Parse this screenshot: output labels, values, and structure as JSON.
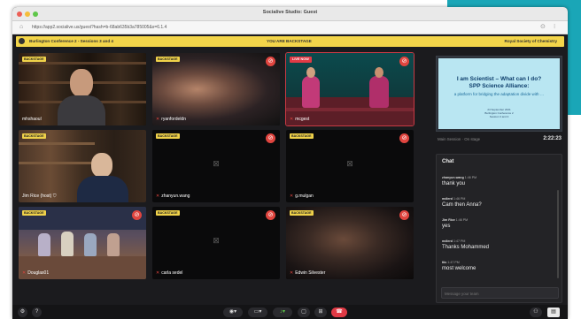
{
  "window": {
    "title": "Socialive Studio: Guest",
    "url": "https://app2.socialive.us/guest?hash=b-68ab635b3a785005&s=6.1.4"
  },
  "banner": {
    "left": "Burlington Conference 2 - Sessions 3 and 4",
    "center": "YOU ARE BACKSTAGE",
    "right": "Royal Society of Chemistry"
  },
  "tiles": [
    {
      "badge": "BACKSTAGE",
      "name": "mhshaoul",
      "muted": false,
      "camera": true
    },
    {
      "badge": "BACKSTAGE",
      "name": "ryanfordeldn",
      "muted": true,
      "camera": true
    },
    {
      "badge": "LIVE NOW",
      "name": "mcgest",
      "muted": true,
      "camera": true
    },
    {
      "badge": "BACKSTAGE",
      "name": "Jim Rice (host)",
      "muted": false,
      "camera": true
    },
    {
      "badge": "BACKSTAGE",
      "name": "zhanyun.wang",
      "muted": true,
      "camera": false
    },
    {
      "badge": "BACKSTAGE",
      "name": "g.mulgan",
      "muted": true,
      "camera": false
    },
    {
      "badge": "BACKSTAGE",
      "name": "Douglas01",
      "muted": true,
      "camera": true
    },
    {
      "badge": "BACKSTAGE",
      "name": "carla sedel",
      "muted": true,
      "camera": false
    },
    {
      "badge": "BACKSTAGE",
      "name": "Edwin Silvester",
      "muted": true,
      "camera": true
    }
  ],
  "slide": {
    "title": "I am Scientist – What can I do?\nSPP Science Alliance:",
    "subtitle": "a platform for bridging the adaptation divide with …",
    "small": "24 September 2021\nBurlington Conference 2\nSession 3 and 4"
  },
  "session": {
    "label": "Main Session · On stage",
    "timer": "2:22:23"
  },
  "chat": {
    "title": "Chat",
    "messages": [
      {
        "author": "zhanyun.wang",
        "time": "1:46 PM",
        "text": "thank you"
      },
      {
        "author": "mdlerd",
        "time": "1:46 PM",
        "text": "Cam then Anna?"
      },
      {
        "author": "Jim Rice",
        "time": "1:46 PM",
        "text": "yes"
      },
      {
        "author": "mdlerd",
        "time": "1:47 PM",
        "text": "Thanks Mohammed"
      },
      {
        "author": "ttic",
        "time": "1:47 PM",
        "text": "most welcome"
      }
    ],
    "placeholder": "Message your team"
  },
  "colors": {
    "accent": "#f0d24a",
    "live": "#e03a45",
    "mute": "#e0453f",
    "teal": "#1aa6b7"
  }
}
